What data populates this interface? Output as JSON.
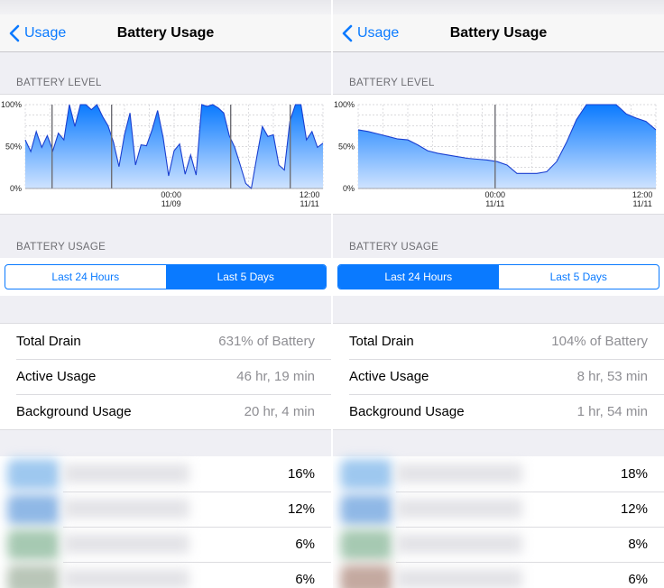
{
  "screens": [
    {
      "id": "left",
      "nav": {
        "back_label": "Usage",
        "title": "Battery Usage"
      },
      "battery_level_header": "BATTERY LEVEL",
      "battery_usage_header": "BATTERY USAGE",
      "segments": [
        {
          "label": "Last 24 Hours",
          "active": false
        },
        {
          "label": "Last 5 Days",
          "active": true
        }
      ],
      "stats": [
        {
          "label": "Total Drain",
          "value": "631% of Battery"
        },
        {
          "label": "Active Usage",
          "value": "46 hr, 19 min"
        },
        {
          "label": "Background Usage",
          "value": "20 hr, 4 min"
        }
      ],
      "apps": [
        {
          "percent": "16%",
          "icon_color": "#9ec8ef"
        },
        {
          "percent": "12%",
          "icon_color": "#8fb8e6"
        },
        {
          "percent": "6%",
          "icon_color": "#a6c9b2"
        },
        {
          "percent": "6%",
          "icon_color": "#b9c6b8"
        }
      ],
      "chart_data": {
        "type": "area",
        "title": "BATTERY LEVEL",
        "y_tick_labels": [
          "100%",
          "50%",
          "0%"
        ],
        "ylim": [
          0,
          100
        ],
        "x_tick_labels": [
          {
            "time": "00:00",
            "date": "11/09"
          },
          {
            "time": "12:00",
            "date": "11/11"
          }
        ],
        "grid": true,
        "fill_color": "#0a7aff",
        "line_color": "#1a3fd0",
        "series": [
          {
            "values": [
              58,
              44,
              68,
              49,
              63,
              45,
              66,
              58,
              100,
              74,
              100,
              100,
              94,
              100,
              86,
              75,
              55,
              26,
              64,
              90,
              28,
              52,
              51,
              70,
              93,
              61,
              15,
              45,
              53,
              17,
              40,
              16,
              100,
              98,
              100,
              96,
              90,
              63,
              49,
              28,
              6,
              0,
              38,
              74,
              62,
              64,
              28,
              22,
              80,
              100,
              100,
              58,
              68,
              49,
              54
            ]
          }
        ]
      }
    },
    {
      "id": "right",
      "nav": {
        "back_label": "Usage",
        "title": "Battery Usage"
      },
      "battery_level_header": "BATTERY LEVEL",
      "battery_usage_header": "BATTERY USAGE",
      "segments": [
        {
          "label": "Last 24 Hours",
          "active": true
        },
        {
          "label": "Last 5 Days",
          "active": false
        }
      ],
      "stats": [
        {
          "label": "Total Drain",
          "value": "104% of Battery"
        },
        {
          "label": "Active Usage",
          "value": "8 hr, 53 min"
        },
        {
          "label": "Background Usage",
          "value": "1 hr, 54 min"
        }
      ],
      "apps": [
        {
          "percent": "18%",
          "icon_color": "#9ec8ef"
        },
        {
          "percent": "12%",
          "icon_color": "#8fb8e6"
        },
        {
          "percent": "8%",
          "icon_color": "#a6c9b2"
        },
        {
          "percent": "6%",
          "icon_color": "#c4a9a0"
        }
      ],
      "chart_data": {
        "type": "area",
        "title": "BATTERY LEVEL",
        "y_tick_labels": [
          "100%",
          "50%",
          "0%"
        ],
        "ylim": [
          0,
          100
        ],
        "x_tick_labels": [
          {
            "time": "00:00",
            "date": "11/11"
          },
          {
            "time": "12:00",
            "date": "11/11"
          }
        ],
        "grid": true,
        "fill_color": "#0a7aff",
        "line_color": "#1a3fd0",
        "series": [
          {
            "values": [
              70,
              68,
              65,
              62,
              59,
              58,
              52,
              45,
              42,
              40,
              38,
              36,
              35,
              34,
              32,
              28,
              18,
              18,
              18,
              20,
              32,
              55,
              82,
              100,
              100,
              100,
              100,
              89,
              84,
              80,
              70
            ]
          }
        ]
      }
    }
  ]
}
